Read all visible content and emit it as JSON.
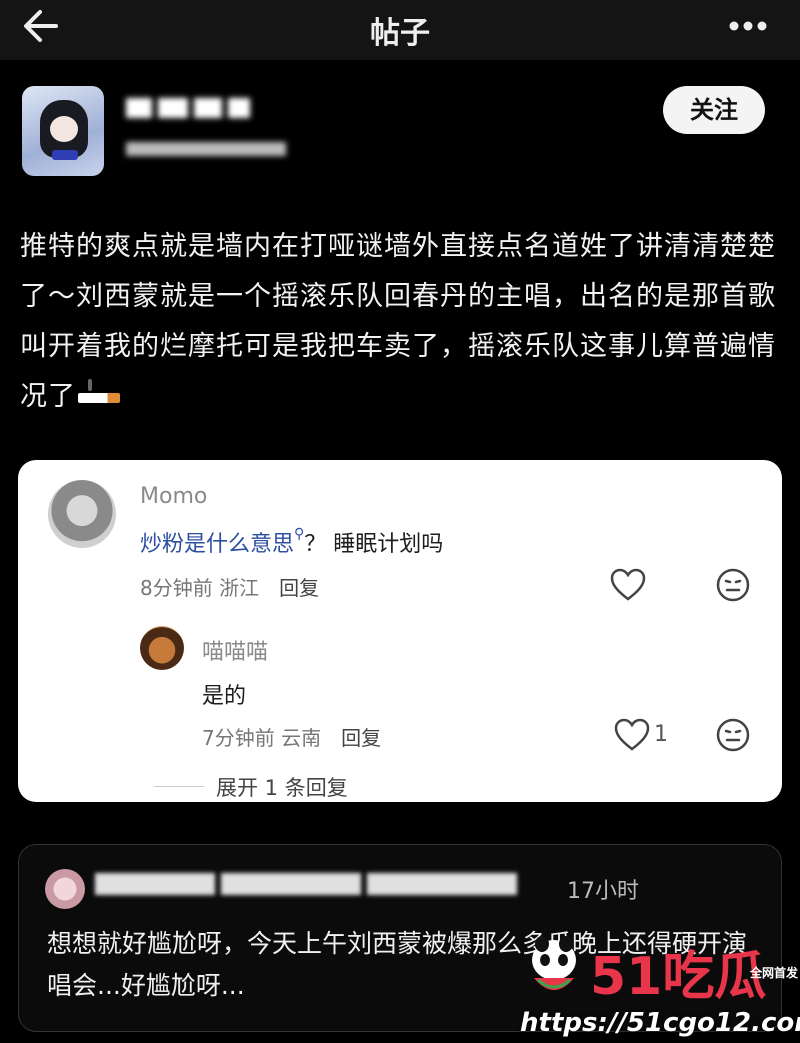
{
  "header": {
    "title": "帖子"
  },
  "post": {
    "follow_label": "关注",
    "text": "推特的爽点就是墙内在打哑谜墙外直接点名道姓了讲清清楚楚了～刘西蒙就是一个摇滚乐队回春丹的主唱，出名的是那首歌叫开着我的烂摩托可是我把车卖了，摇滚乐队这事儿算普遍情况了"
  },
  "comment": {
    "author": "Momo",
    "text_link": "炒粉是什么意思",
    "text_rest": "？ 睡眠计划吗",
    "meta": "8分钟前 浙江",
    "reply_label": "回复",
    "reply": {
      "author": "喵喵喵",
      "text": "是的",
      "meta": "7分钟前 云南",
      "reply_label": "回复",
      "likes": "1"
    },
    "expand_label": "展开 1 条回复"
  },
  "quote": {
    "time": "17小时",
    "text": "想想就好尴尬呀，今天上午刘西蒙被爆那么多瓜晚上还得硬开演唱会...好尴尬呀..."
  },
  "watermark": {
    "logo": "51吃瓜",
    "tag": "全网首发",
    "url": "https://51cgo12.com"
  },
  "icons": [
    "back-arrow-icon",
    "more-dots-icon",
    "heart-icon",
    "emoji-face-icon",
    "search-icon",
    "cigarette-icon"
  ]
}
